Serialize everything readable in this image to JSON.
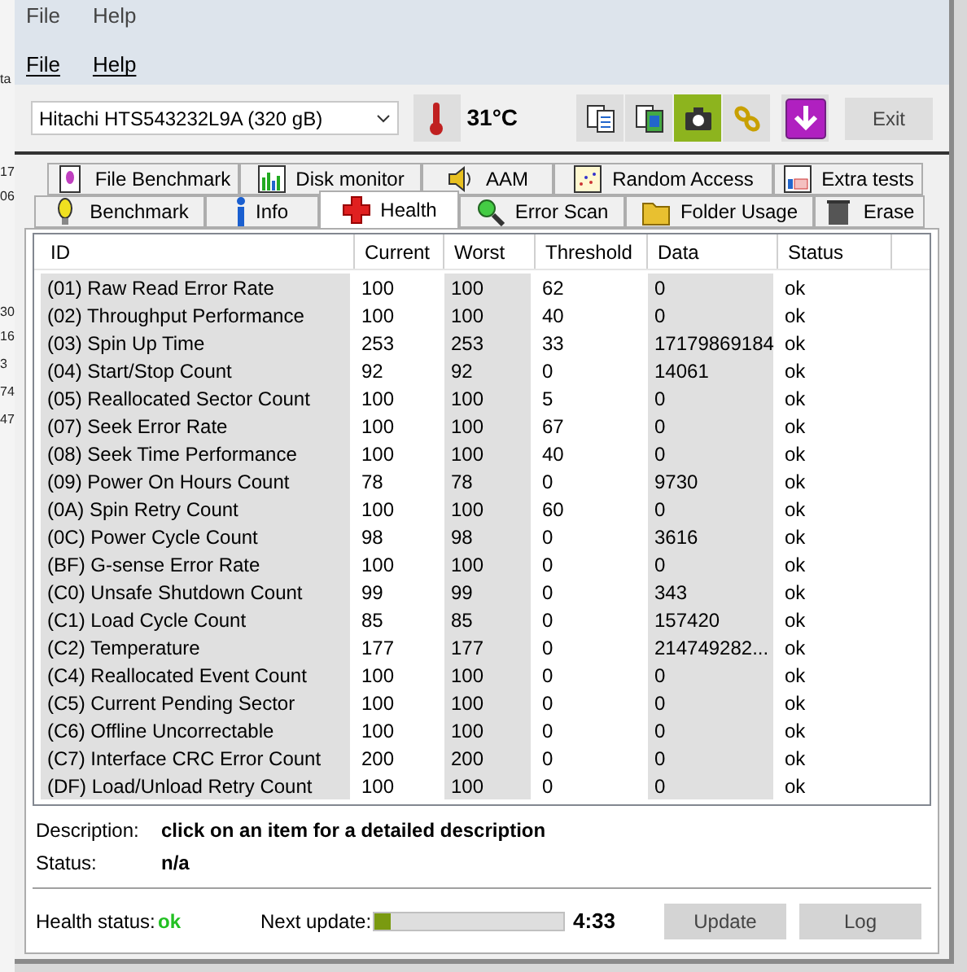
{
  "ghost_menu": [
    "File",
    "Help"
  ],
  "menu": [
    "File",
    "Help"
  ],
  "background_fragments": [
    "ta",
    "17",
    "06",
    "30",
    "16",
    "3",
    "74",
    "47"
  ],
  "drive_select": {
    "value": "Hitachi HTS543232L9A (320 gB)"
  },
  "temperature": "31°C",
  "toolbar_buttons": [
    {
      "kind": "copy",
      "selected": false
    },
    {
      "kind": "copy-color",
      "selected": false
    },
    {
      "kind": "camera",
      "selected": true
    },
    {
      "kind": "tools",
      "selected": false
    },
    {
      "kind": "download",
      "selected": false
    }
  ],
  "exit_button": "Exit",
  "tabs_top": [
    {
      "label": "File Benchmark",
      "kind": "file",
      "selected": false
    },
    {
      "label": "Disk monitor",
      "kind": "chart",
      "selected": false
    },
    {
      "label": "AAM",
      "kind": "speaker",
      "selected": false
    },
    {
      "label": "Random Access",
      "kind": "scatter",
      "selected": false
    },
    {
      "label": "Extra tests",
      "kind": "grid",
      "selected": false
    }
  ],
  "tabs_bottom": [
    {
      "label": "Benchmark",
      "kind": "bulb",
      "selected": false
    },
    {
      "label": "Info",
      "kind": "info",
      "selected": false
    },
    {
      "label": "Health",
      "kind": "cross",
      "selected": true
    },
    {
      "label": "Error Scan",
      "kind": "magnifier",
      "selected": false
    },
    {
      "label": "Folder Usage",
      "kind": "folder",
      "selected": false
    },
    {
      "label": "Erase",
      "kind": "trash",
      "selected": false
    }
  ],
  "table": {
    "columns": [
      "ID",
      "Current",
      "Worst",
      "Threshold",
      "Data",
      "Status"
    ],
    "rows": [
      [
        "(01) Raw Read Error Rate",
        "100",
        "100",
        "62",
        "0",
        "ok"
      ],
      [
        "(02) Throughput Performance",
        "100",
        "100",
        "40",
        "0",
        "ok"
      ],
      [
        "(03) Spin Up Time",
        "253",
        "253",
        "33",
        "17179869184",
        "ok"
      ],
      [
        "(04) Start/Stop Count",
        "92",
        "92",
        "0",
        "14061",
        "ok"
      ],
      [
        "(05) Reallocated Sector Count",
        "100",
        "100",
        "5",
        "0",
        "ok"
      ],
      [
        "(07) Seek Error Rate",
        "100",
        "100",
        "67",
        "0",
        "ok"
      ],
      [
        "(08) Seek Time Performance",
        "100",
        "100",
        "40",
        "0",
        "ok"
      ],
      [
        "(09) Power On Hours Count",
        "78",
        "78",
        "0",
        "9730",
        "ok"
      ],
      [
        "(0A) Spin Retry Count",
        "100",
        "100",
        "60",
        "0",
        "ok"
      ],
      [
        "(0C) Power Cycle Count",
        "98",
        "98",
        "0",
        "3616",
        "ok"
      ],
      [
        "(BF) G-sense Error Rate",
        "100",
        "100",
        "0",
        "0",
        "ok"
      ],
      [
        "(C0) Unsafe Shutdown Count",
        "99",
        "99",
        "0",
        "343",
        "ok"
      ],
      [
        "(C1) Load Cycle Count",
        "85",
        "85",
        "0",
        "157420",
        "ok"
      ],
      [
        "(C2) Temperature",
        "177",
        "177",
        "0",
        "214749282...",
        "ok"
      ],
      [
        "(C4) Reallocated Event Count",
        "100",
        "100",
        "0",
        "0",
        "ok"
      ],
      [
        "(C5) Current Pending Sector",
        "100",
        "100",
        "0",
        "0",
        "ok"
      ],
      [
        "(C6) Offline Uncorrectable",
        "100",
        "100",
        "0",
        "0",
        "ok"
      ],
      [
        "(C7) Interface CRC Error Count",
        "200",
        "200",
        "0",
        "0",
        "ok"
      ],
      [
        "(DF) Load/Unload Retry Count",
        "100",
        "100",
        "0",
        "0",
        "ok"
      ]
    ]
  },
  "description": {
    "label": "Description:",
    "value": "click on an item for a detailed description"
  },
  "status": {
    "label": "Status:",
    "value": "n/a"
  },
  "health_status": {
    "label": "Health status:",
    "value": "ok"
  },
  "next_update": {
    "label": "Next update:",
    "level": 0.09,
    "time": "4:33"
  },
  "buttons": [
    "Update",
    "Log"
  ]
}
